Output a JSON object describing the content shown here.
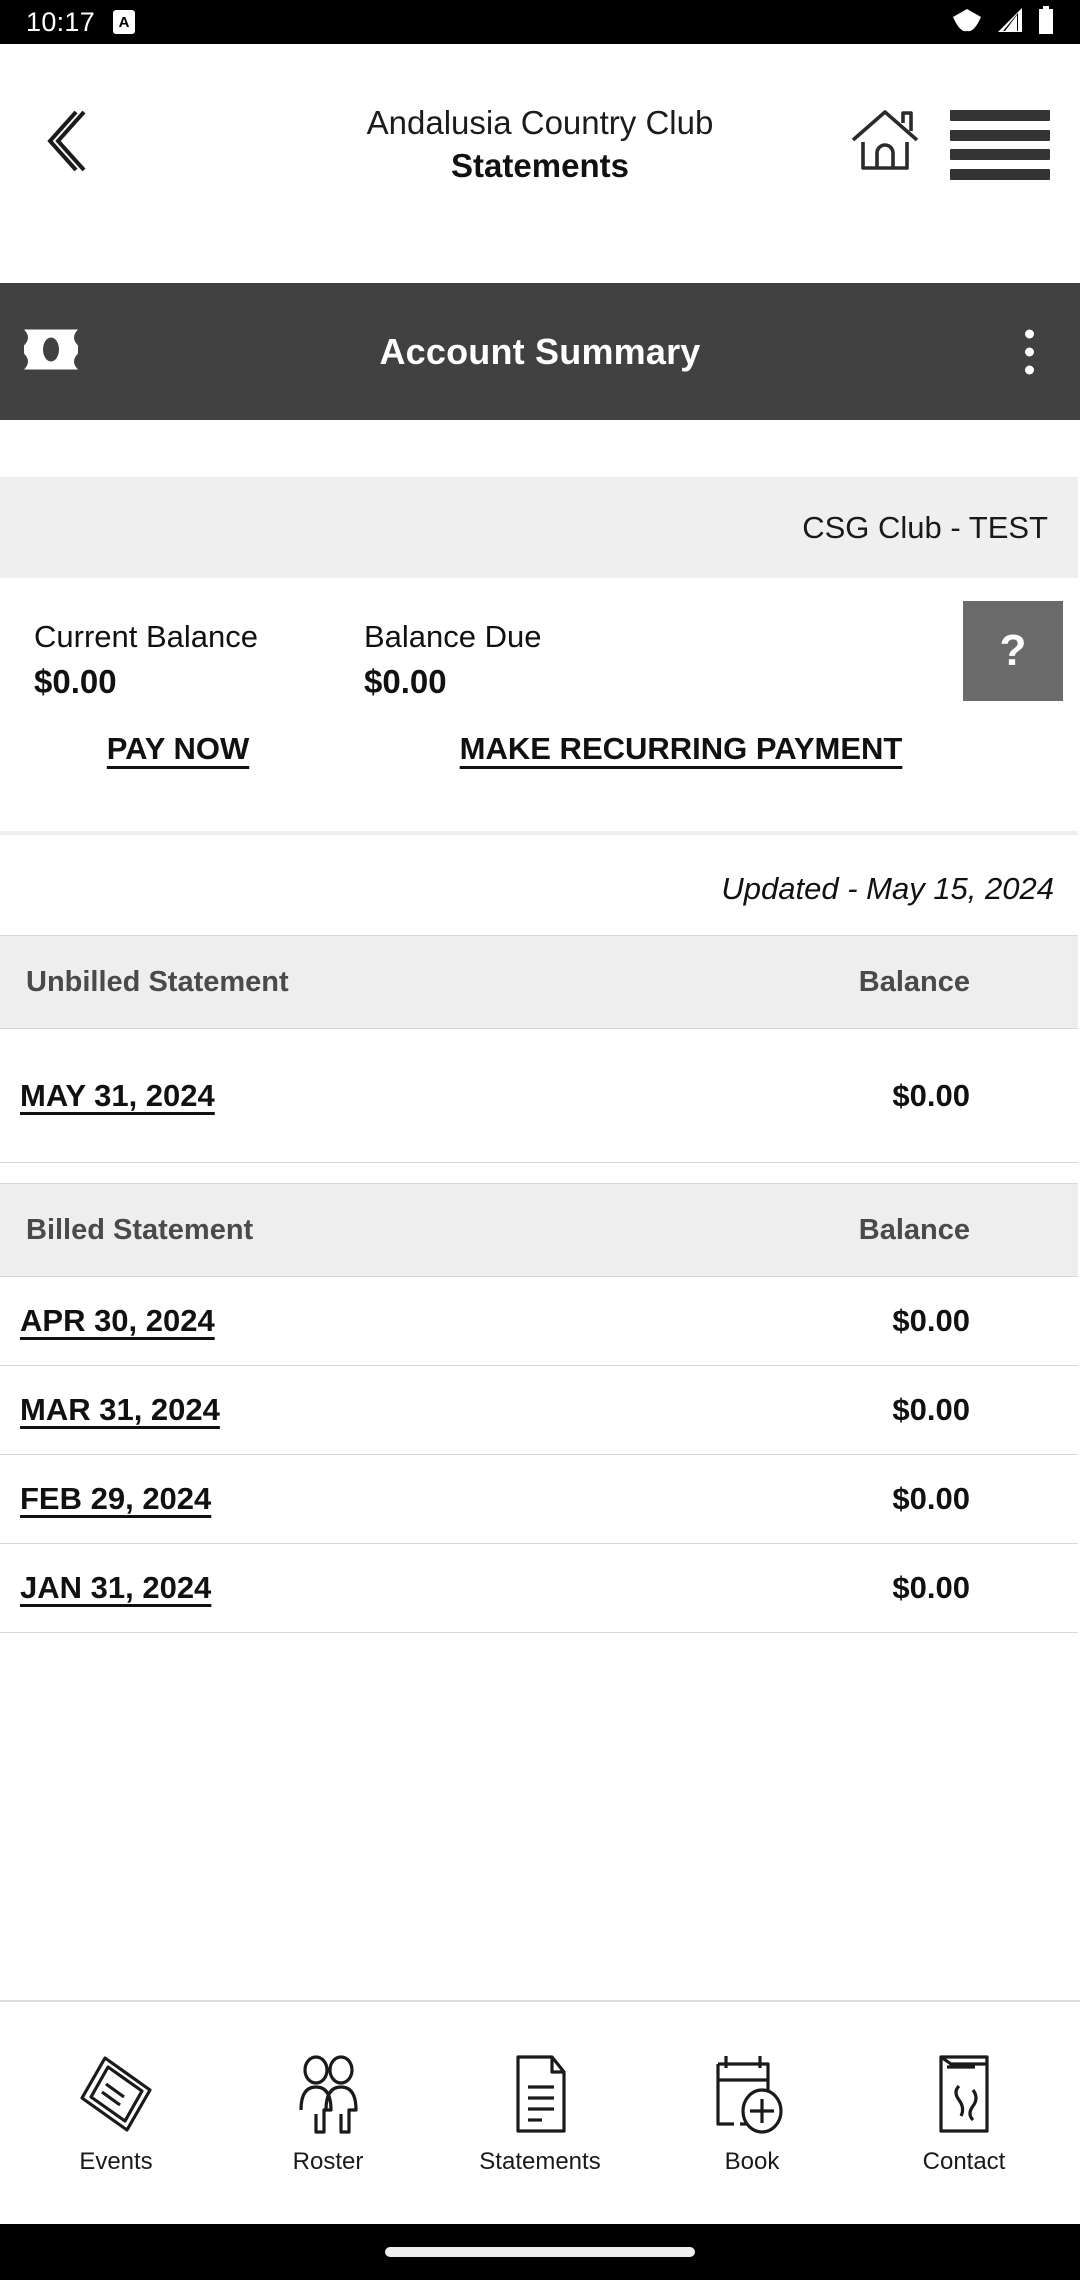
{
  "status_bar": {
    "time": "10:17",
    "notification_badge": "A",
    "icons": [
      "wifi-icon",
      "cellular-signal-icon",
      "battery-icon"
    ]
  },
  "app_header": {
    "back_icon": "chevron-left-icon",
    "club_name": "Andalusia Country Club",
    "page_title": "Statements",
    "home_icon": "home-icon",
    "menu_icon": "hamburger-menu-icon"
  },
  "account_bar": {
    "money_icon": "banknote-icon",
    "title": "Account Summary",
    "overflow_icon": "more-vertical-icon"
  },
  "account": {
    "club_label": "CSG Club - TEST",
    "current_balance_label": "Current Balance",
    "current_balance_value": "$0.00",
    "balance_due_label": "Balance Due",
    "balance_due_value": "$0.00",
    "help_icon": "question-mark-icon",
    "pay_now_label": "PAY NOW",
    "recurring_payment_label": "MAKE RECURRING PAYMENT",
    "updated_text": "Updated - May 15, 2024"
  },
  "unbilled": {
    "header_name": "Unbilled Statement",
    "header_balance": "Balance",
    "rows": [
      {
        "date": "MAY 31, 2024",
        "balance": "$0.00"
      }
    ]
  },
  "billed": {
    "header_name": "Billed Statement",
    "header_balance": "Balance",
    "rows": [
      {
        "date": "APR 30, 2024",
        "balance": "$0.00"
      },
      {
        "date": "MAR 31, 2024",
        "balance": "$0.00"
      },
      {
        "date": "FEB 29, 2024",
        "balance": "$0.00"
      },
      {
        "date": "JAN 31, 2024",
        "balance": "$0.00"
      }
    ]
  },
  "bottom_nav": {
    "items": [
      {
        "label": "Events",
        "icon": "ticket-icon"
      },
      {
        "label": "Roster",
        "icon": "people-icon"
      },
      {
        "label": "Statements",
        "icon": "document-icon"
      },
      {
        "label": "Book",
        "icon": "calendar-plus-icon"
      },
      {
        "label": "Contact",
        "icon": "contact-card-icon"
      }
    ]
  },
  "colors": {
    "account_bar_bg": "#414141",
    "help_button_bg": "#6b6b6b",
    "row_header_bg": "#eeeeee",
    "club_row_bg": "#efefef",
    "status_bar_bg": "#000000"
  }
}
